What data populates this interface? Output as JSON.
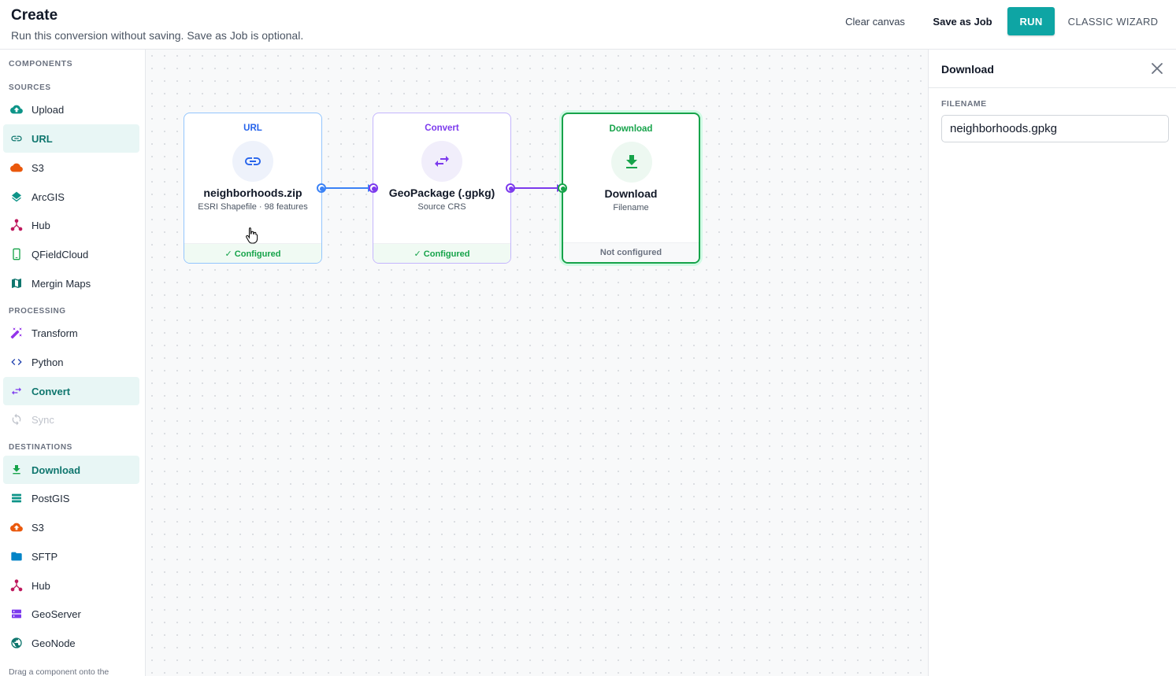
{
  "header": {
    "title": "Create",
    "subtitle": "Run this conversion without saving. Save as Job is optional.",
    "clear_label": "Clear canvas",
    "save_label": "Save as Job",
    "run_label": "RUN",
    "classic_label": "CLASSIC WIZARD"
  },
  "sidebar": {
    "heading": "COMPONENTS",
    "sources_label": "SOURCES",
    "processing_label": "PROCESSING",
    "destinations_label": "DESTINATIONS",
    "sources": [
      {
        "label": "Upload",
        "icon": "cloud-upload-icon"
      },
      {
        "label": "URL",
        "icon": "link-icon",
        "active": true
      },
      {
        "label": "S3",
        "icon": "cloud-icon"
      },
      {
        "label": "ArcGIS",
        "icon": "layers-icon"
      },
      {
        "label": "Hub",
        "icon": "hub-icon"
      },
      {
        "label": "QFieldCloud",
        "icon": "phone-icon"
      },
      {
        "label": "Mergin Maps",
        "icon": "map-icon"
      }
    ],
    "processing": [
      {
        "label": "Transform",
        "icon": "magic-wand-icon"
      },
      {
        "label": "Python",
        "icon": "code-icon"
      },
      {
        "label": "Convert",
        "icon": "swap-icon",
        "active": true
      },
      {
        "label": "Sync",
        "icon": "sync-icon",
        "disabled": true
      }
    ],
    "destinations": [
      {
        "label": "Download",
        "icon": "download-icon",
        "active": true
      },
      {
        "label": "PostGIS",
        "icon": "database-icon"
      },
      {
        "label": "S3",
        "icon": "cloud-upload-icon"
      },
      {
        "label": "SFTP",
        "icon": "folder-icon"
      },
      {
        "label": "Hub",
        "icon": "hub-icon"
      },
      {
        "label": "GeoServer",
        "icon": "server-icon"
      },
      {
        "label": "GeoNode",
        "icon": "globe-icon"
      }
    ],
    "footer": "Drag a component onto the"
  },
  "canvas": {
    "nodes": [
      {
        "type": "URL",
        "title": "neighborhoods.zip",
        "desc": "ESRI Shapefile · 98 features",
        "status": "✓ Configured",
        "icon": "link-icon"
      },
      {
        "type": "Convert",
        "title": "GeoPackage (.gpkg)",
        "desc": "Source CRS",
        "status": "✓ Configured",
        "icon": "swap-icon"
      },
      {
        "type": "Download",
        "title": "Download",
        "desc": "Filename",
        "status": "Not configured",
        "icon": "download-icon"
      }
    ]
  },
  "panel": {
    "title": "Download",
    "field_label": "FILENAME",
    "filename_value": "neighborhoods.gpkg"
  },
  "colors": {
    "accent": "#0ea5a4",
    "url": "#2563eb",
    "convert": "#7c3aed",
    "download": "#16a34a"
  }
}
